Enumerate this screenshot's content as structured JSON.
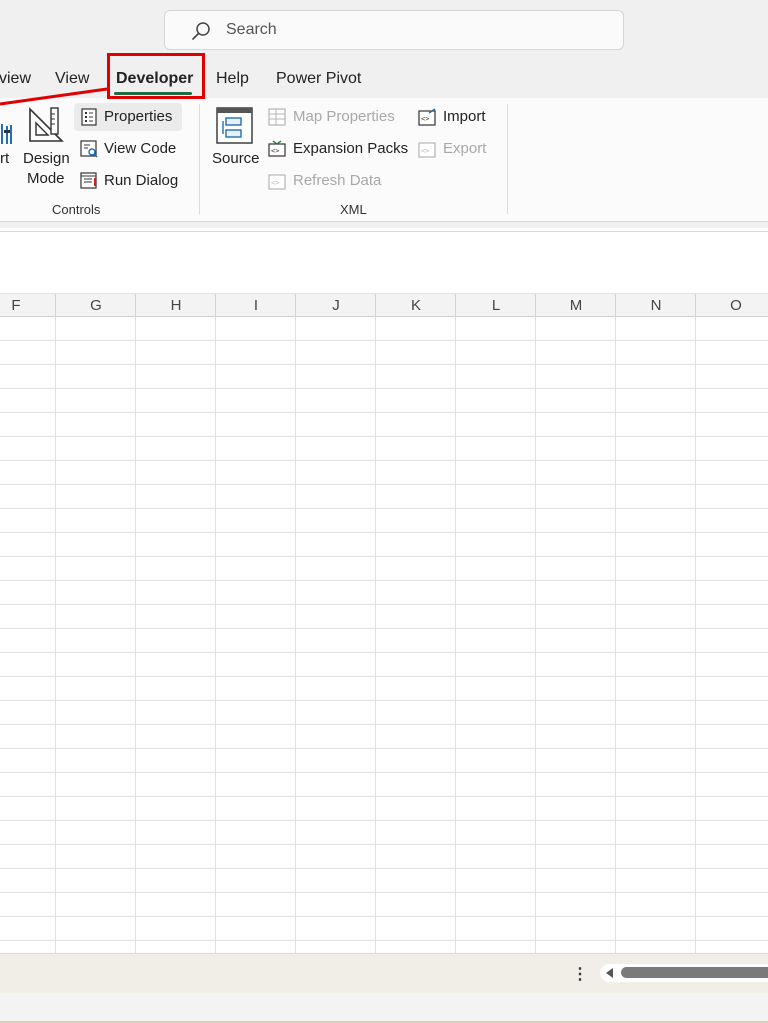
{
  "search": {
    "placeholder": "Search"
  },
  "tabs": [
    {
      "label": "view"
    },
    {
      "label": "View"
    },
    {
      "label": "Developer"
    },
    {
      "label": "Help"
    },
    {
      "label": "Power Pivot"
    }
  ],
  "ribbon": {
    "controls": {
      "insert_fragment": "rt",
      "design_mode_line1": "Design",
      "design_mode_line2": "Mode",
      "properties": "Properties",
      "view_code": "View Code",
      "run_dialog": "Run Dialog",
      "group_label": "Controls"
    },
    "xml": {
      "source": "Source",
      "map_properties": "Map Properties",
      "expansion_packs": "Expansion Packs",
      "refresh_data": "Refresh Data",
      "import": "Import",
      "export": "Export",
      "group_label": "XML"
    }
  },
  "columns": [
    "F",
    "G",
    "H",
    "I",
    "J",
    "K",
    "L",
    "M",
    "N",
    "O"
  ],
  "colors": {
    "accent": "#1e6c41",
    "highlight": "#e00000"
  }
}
